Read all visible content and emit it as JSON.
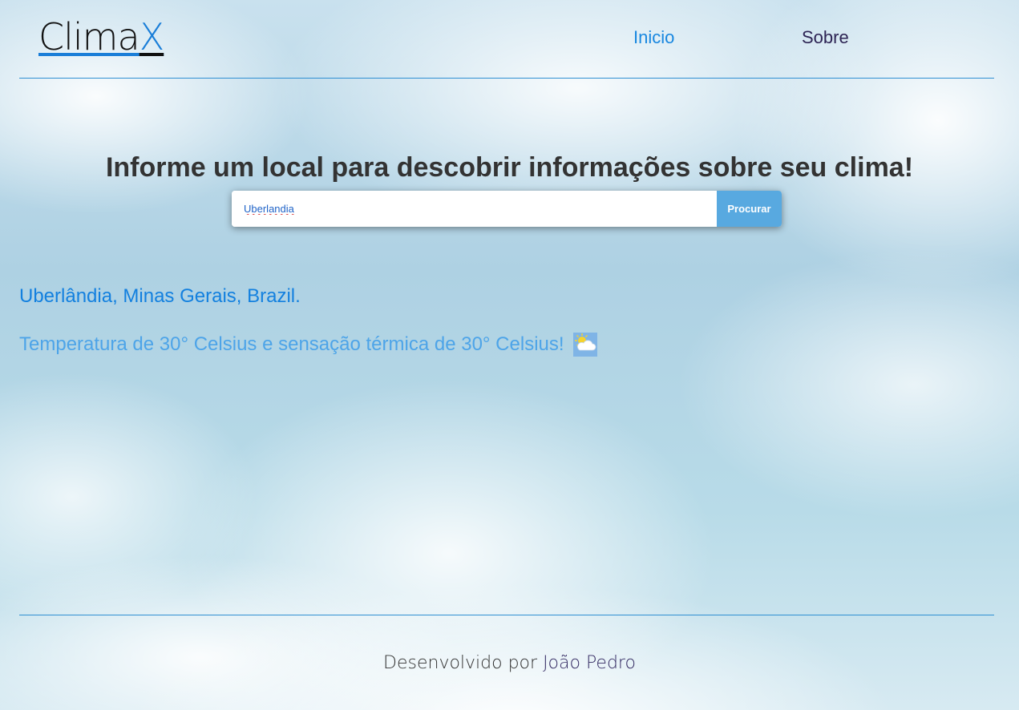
{
  "header": {
    "logo_main": "Clima",
    "logo_accent": "X",
    "nav": {
      "inicio": "Inicio",
      "sobre": "Sobre"
    }
  },
  "main": {
    "headline": "Informe um local para descobrir informações sobre seu clima!",
    "search": {
      "value": "Uberlandia",
      "button_label": "Procurar"
    },
    "result": {
      "location": "Uberlândia, Minas Gerais, Brazil.",
      "temperature_text": "Temperatura de 30° Celsius e sensação térmica de 30° Celsius!",
      "weather_icon": "partly-cloudy-icon"
    }
  },
  "footer": {
    "prefix": "Desenvolvido por",
    "author": "João Pedro"
  },
  "colors": {
    "accent": "#1a7ed8",
    "button": "#58a9e0",
    "location_text": "#1380df",
    "temperature_text": "#4da4e8"
  }
}
